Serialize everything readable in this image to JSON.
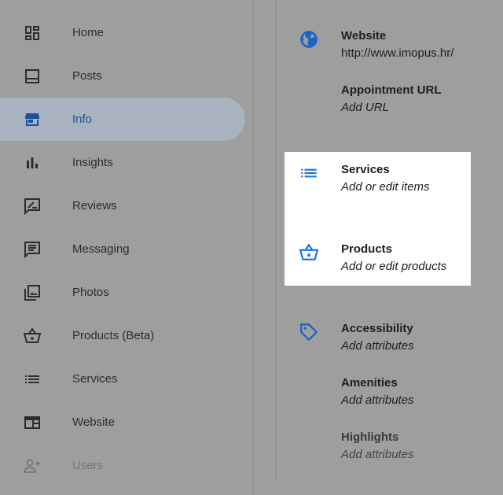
{
  "sidebar": {
    "items": [
      {
        "label": "Home",
        "icon": "dashboard-icon"
      },
      {
        "label": "Posts",
        "icon": "posts-icon"
      },
      {
        "label": "Info",
        "icon": "store-icon",
        "active": true
      },
      {
        "label": "Insights",
        "icon": "bar-chart-icon"
      },
      {
        "label": "Reviews",
        "icon": "review-icon"
      },
      {
        "label": "Messaging",
        "icon": "message-icon"
      },
      {
        "label": "Photos",
        "icon": "photos-icon"
      },
      {
        "label": "Products (Beta)",
        "icon": "basket-icon"
      },
      {
        "label": "Services",
        "icon": "list-icon"
      },
      {
        "label": "Website",
        "icon": "website-icon"
      },
      {
        "label": "Users",
        "icon": "add-user-icon",
        "disabled": true
      }
    ]
  },
  "info": {
    "website": {
      "title": "Website",
      "value": "http://www.imopus.hr/"
    },
    "appointment": {
      "title": "Appointment URL",
      "value": "Add URL"
    },
    "services": {
      "title": "Services",
      "value": "Add or edit items"
    },
    "products": {
      "title": "Products",
      "value": "Add or edit products"
    },
    "accessibility": {
      "title": "Accessibility",
      "value": "Add attributes"
    },
    "amenities": {
      "title": "Amenities",
      "value": "Add attributes"
    },
    "highlights": {
      "title": "Highlights",
      "value": "Add attributes"
    }
  },
  "colors": {
    "accent": "#1a73e8",
    "active_bg": "#a9b2bf",
    "overlay": "#9e9e9e",
    "highlight": "#ffffff"
  }
}
